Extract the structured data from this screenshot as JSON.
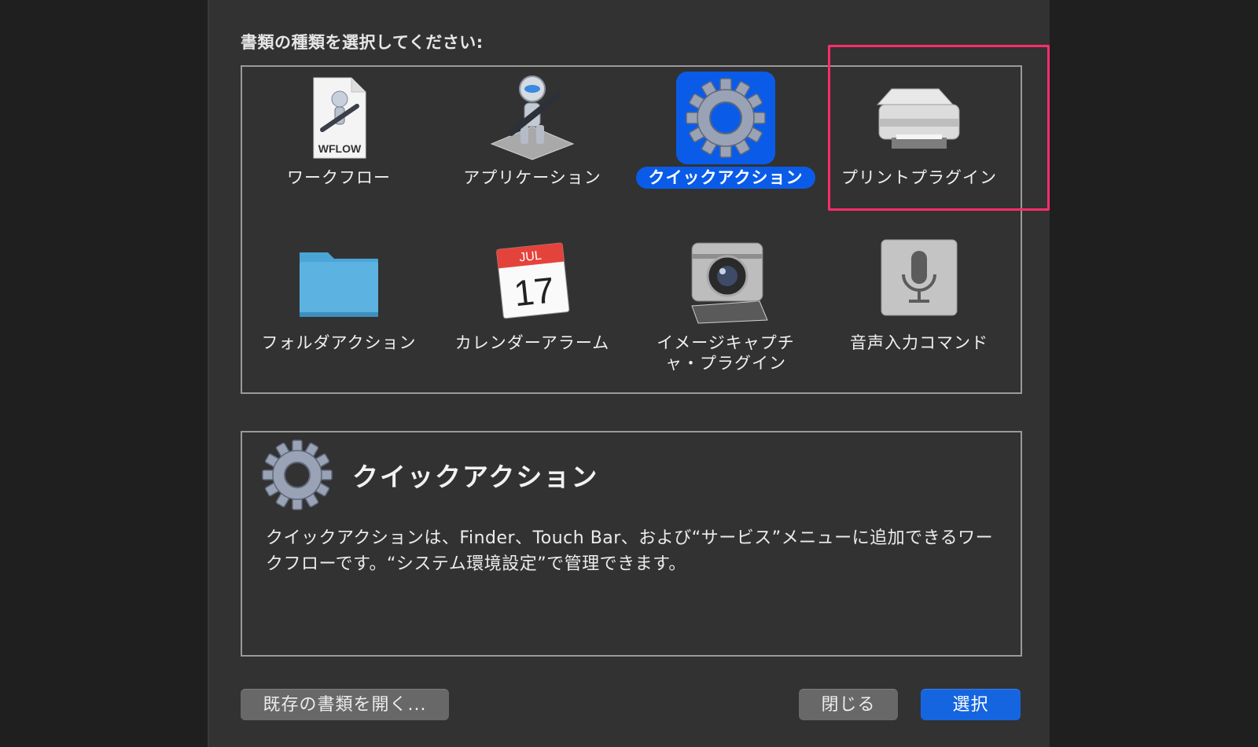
{
  "dialog": {
    "prompt": "書類の種類を選択してください:",
    "doc_types": [
      {
        "label": "ワークフロー",
        "icon": "workflow-file-icon",
        "selected": false
      },
      {
        "label": "アプリケーション",
        "icon": "automator-robot-icon",
        "selected": false
      },
      {
        "label": "クイックアクション",
        "icon": "gear-icon",
        "selected": true
      },
      {
        "label": "プリントプラグイン",
        "icon": "printer-icon",
        "selected": false
      },
      {
        "label": "フォルダアクション",
        "icon": "folder-icon",
        "selected": false
      },
      {
        "label": "カレンダーアラーム",
        "icon": "calendar-icon",
        "selected": false
      },
      {
        "label": "イメージキャプチャ・プラグイン",
        "label_line1": "イメージキャプチ",
        "label_line2": "ャ・プラグイン",
        "icon": "camera-icon",
        "selected": false
      },
      {
        "label": "音声入力コマンド",
        "icon": "microphone-icon",
        "selected": false
      }
    ],
    "workflow_icon_text": "WFLOW",
    "calendar_icon": {
      "month": "JUL",
      "day": "17"
    },
    "description": {
      "title": "クイックアクション",
      "body": "クイックアクションは、Finder、Touch Bar、および“サービス”メニューに追加できるワークフローです。“システム環境設定”で管理できます。"
    },
    "buttons": {
      "open_existing": "既存の書類を開く...",
      "close": "閉じる",
      "choose": "選択"
    }
  },
  "colors": {
    "selection": "#0a5ce8",
    "highlight_frame": "#ff2d6b",
    "primary_button": "#1565e0"
  }
}
